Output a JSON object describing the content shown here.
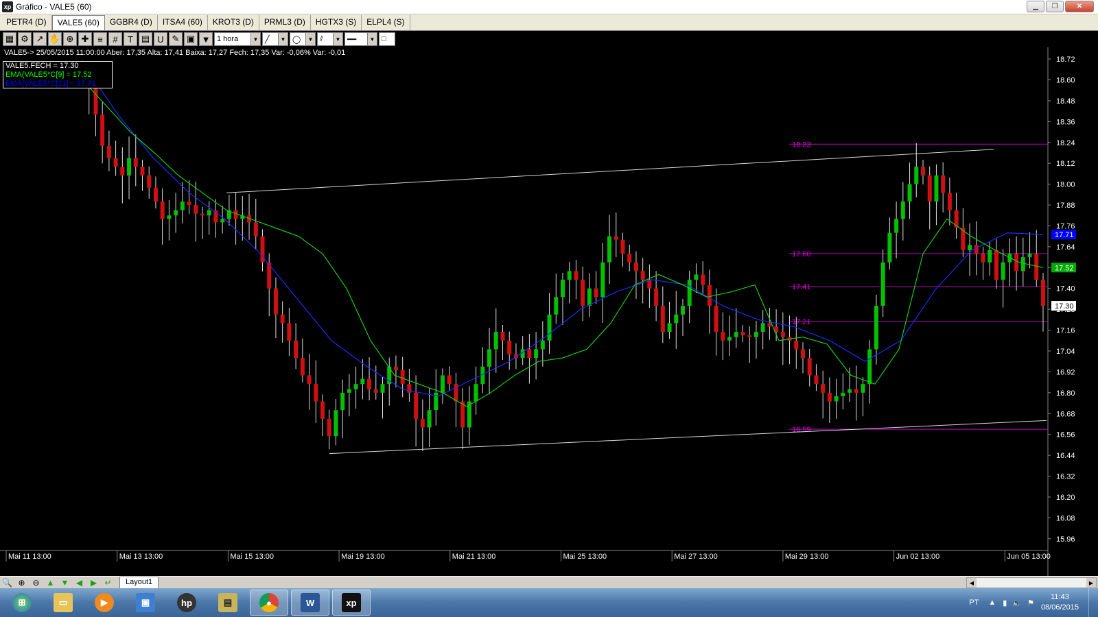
{
  "window": {
    "title": "Gráfico - VALE5 (60)",
    "logo": "xp"
  },
  "tabs": [
    {
      "label": "PETR4 (D)",
      "active": false
    },
    {
      "label": "VALE5 (60)",
      "active": true
    },
    {
      "label": "GGBR4 (D)",
      "active": false
    },
    {
      "label": "ITSA4 (60)",
      "active": false
    },
    {
      "label": "KROT3 (D)",
      "active": false
    },
    {
      "label": "PRML3 (D)",
      "active": false
    },
    {
      "label": "HGTX3 (S)",
      "active": false
    },
    {
      "label": "ELPL4 (S)",
      "active": false
    }
  ],
  "toolbar": {
    "interval": "1 hora",
    "icons": [
      "chart-type-icon",
      "settings-gear-icon",
      "line-tool-icon",
      "hand-pan-icon",
      "zoom-icon",
      "crosshair-icon",
      "fibonacci-icon",
      "grid-icon",
      "text-icon",
      "calculator-icon",
      "magnet-icon",
      "eraser-icon",
      "trash-icon",
      "filter-icon"
    ]
  },
  "infoline": "VALE5-> 25/05/2015 11:00:00 Aber: 17,35 Alta: 17,41 Baixa: 17,27 Fech: 17,35 Var: -0,06% Var: -0,01",
  "legend": [
    {
      "text": "VALE5.FECH = 17.30",
      "color": "#ffffff"
    },
    {
      "text": "EMA(VALE5*C[9] = 17.52",
      "color": "#00ff00"
    },
    {
      "text": "EMA(VALE5*C[21] = 17.71",
      "color": "#0000ff"
    }
  ],
  "chart_data": {
    "type": "candlestick",
    "symbol": "VALE5",
    "ylim": [
      15.9,
      18.74
    ],
    "yticks": [
      18.72,
      18.6,
      18.48,
      18.36,
      18.24,
      18.12,
      18.0,
      17.88,
      17.76,
      17.64,
      17.52,
      17.4,
      17.28,
      17.16,
      17.04,
      16.92,
      16.8,
      16.68,
      16.56,
      16.44,
      16.32,
      16.2,
      16.08,
      15.96
    ],
    "xlabels": [
      "Mai 11 13:00",
      "Mai 13 13:00",
      "Mai 15 13:00",
      "Mai 19 13:00",
      "Mai 21 13:00",
      "Mai 25 13:00",
      "Mai 27 13:00",
      "Mai 29 13:00",
      "Jun 02 13:00",
      "Jun 05 13:00"
    ],
    "hlines": [
      {
        "value": 18.23,
        "label": "18.23"
      },
      {
        "value": 17.6,
        "label": "17.60"
      },
      {
        "value": 17.41,
        "label": "17.41"
      },
      {
        "value": 17.21,
        "label": "17.21"
      },
      {
        "value": 16.59,
        "label": "16.59"
      }
    ],
    "price_badges": [
      {
        "value": 17.71,
        "label": "17.71",
        "color": "#0000ff"
      },
      {
        "value": 17.52,
        "label": "17.52",
        "color": "#00aa00"
      },
      {
        "value": 17.3,
        "label": "17.30",
        "color": "#ffffff"
      }
    ],
    "closes": [
      18.62,
      18.55,
      18.4,
      18.22,
      18.15,
      18.1,
      18.05,
      18.15,
      18.1,
      18.05,
      17.98,
      17.9,
      17.8,
      17.82,
      17.85,
      17.9,
      17.88,
      17.83,
      17.82,
      17.85,
      17.78,
      17.8,
      17.85,
      17.8,
      17.82,
      17.78,
      17.7,
      17.55,
      17.4,
      17.25,
      17.2,
      17.1,
      17.0,
      16.9,
      16.85,
      16.75,
      16.65,
      16.55,
      16.7,
      16.8,
      16.82,
      16.85,
      16.88,
      16.82,
      16.8,
      16.85,
      16.95,
      16.93,
      16.85,
      16.8,
      16.65,
      16.6,
      16.7,
      16.8,
      16.9,
      16.85,
      16.75,
      16.6,
      16.75,
      16.85,
      16.95,
      17.05,
      17.15,
      17.1,
      17.02,
      17.0,
      17.05,
      17.0,
      17.05,
      17.1,
      17.25,
      17.35,
      17.45,
      17.5,
      17.45,
      17.3,
      17.4,
      17.35,
      17.55,
      17.7,
      17.68,
      17.6,
      17.55,
      17.5,
      17.45,
      17.4,
      17.3,
      17.15,
      17.2,
      17.25,
      17.3,
      17.45,
      17.48,
      17.42,
      17.3,
      17.15,
      17.1,
      17.12,
      17.15,
      17.13,
      17.12,
      17.15,
      17.2,
      17.18,
      17.15,
      17.12,
      17.1,
      17.05,
      17.0,
      16.9,
      16.85,
      16.8,
      16.75,
      16.78,
      16.8,
      16.82,
      16.8,
      16.85,
      17.05,
      17.3,
      17.55,
      17.72,
      17.8,
      17.9,
      18.0,
      18.1,
      18.05,
      17.9,
      18.05,
      17.95,
      17.85,
      17.75,
      17.62,
      17.65,
      17.6,
      17.55,
      17.62,
      17.45,
      17.55,
      17.6,
      17.5,
      17.58,
      17.6,
      17.45,
      17.3
    ],
    "ema9": [
      18.6,
      18.45,
      18.3,
      18.18,
      18.05,
      17.95,
      17.85,
      17.8,
      17.75,
      17.7,
      17.6,
      17.4,
      17.1,
      16.9,
      16.85,
      16.8,
      16.72,
      16.8,
      16.9,
      16.98,
      17.0,
      17.05,
      17.2,
      17.42,
      17.48,
      17.42,
      17.35,
      17.38,
      17.42,
      17.1,
      17.12,
      17.08,
      16.9,
      16.85,
      17.05,
      17.6,
      17.8,
      17.7,
      17.62,
      17.55,
      17.52
    ],
    "ema21": [
      18.7,
      18.4,
      18.15,
      17.95,
      17.8,
      17.6,
      17.35,
      17.1,
      16.95,
      16.82,
      16.78,
      16.88,
      16.98,
      17.12,
      17.28,
      17.38,
      17.45,
      17.42,
      17.3,
      17.22,
      17.18,
      17.1,
      16.98,
      17.1,
      17.4,
      17.62,
      17.72,
      17.71
    ],
    "trendlines": [
      {
        "from": [
          330,
          17.95
        ],
        "to": [
          1448,
          18.2
        ]
      },
      {
        "from": [
          480,
          16.45
        ],
        "to": [
          1525,
          16.64
        ]
      }
    ]
  },
  "bottombar": {
    "icons": [
      "zoom-icon",
      "zoom-in-icon",
      "zoom-out-icon",
      "arrow-up-icon",
      "arrow-down-icon",
      "arrow-left-icon",
      "arrow-right-icon",
      "arrow-return-icon"
    ],
    "layout_tab": "Layout1"
  },
  "taskbar": {
    "apps": [
      "start-orb-icon",
      "explorer-folder-icon",
      "media-player-icon",
      "remote-desktop-icon",
      "hp-icon",
      "clipboard-app-icon",
      "chrome-icon",
      "word-icon",
      "xp-app-icon"
    ],
    "lang": "PT",
    "time": "11:43",
    "date": "08/06/2015"
  }
}
